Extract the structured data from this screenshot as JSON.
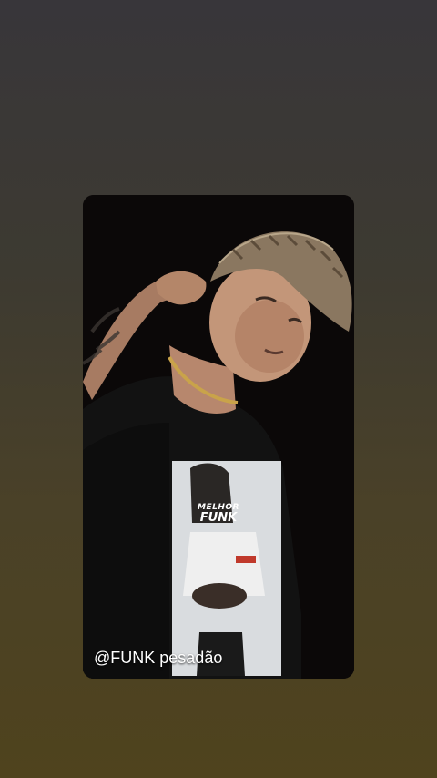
{
  "story": {
    "caption": "@FUNK pesadão",
    "shirt_logo_line1": "MELHOR",
    "shirt_logo_line2": "FUNK"
  }
}
